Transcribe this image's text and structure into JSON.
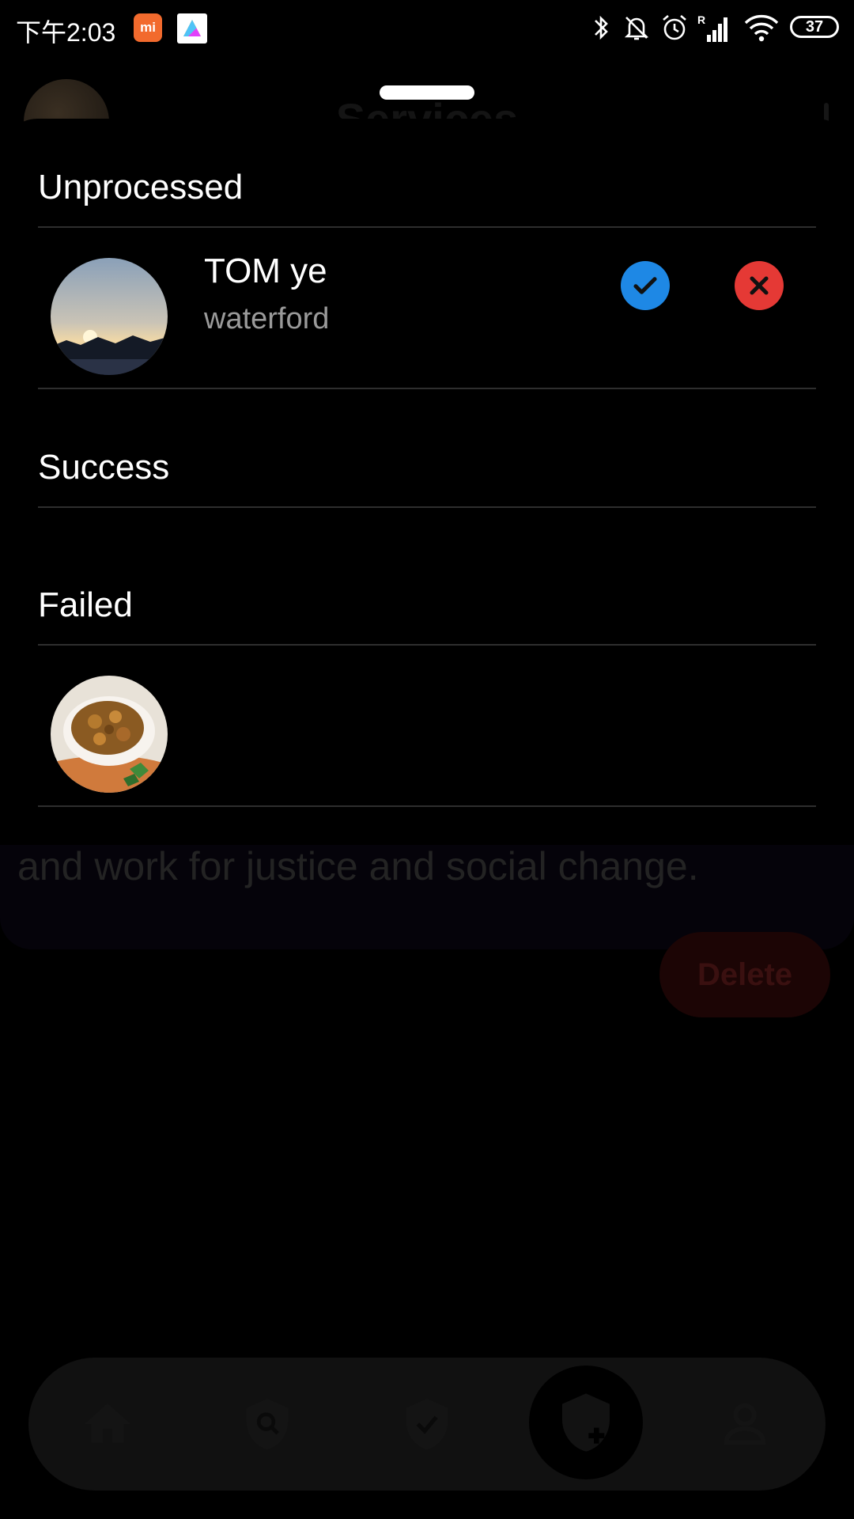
{
  "status_bar": {
    "time": "下午2:03",
    "battery": "37",
    "notification_icons": [
      "mi-app-icon",
      "app-icon"
    ],
    "system_icons": [
      "bluetooth-icon",
      "bell-off-icon",
      "alarm-icon",
      "signal-icon",
      "wifi-icon",
      "battery-icon"
    ]
  },
  "background": {
    "title": "Services",
    "card_text": "and work for justice and social change.",
    "delete_label": "Delete",
    "nav_items": [
      "home-icon",
      "shield-search-icon",
      "shield-check-icon",
      "shield-add-icon",
      "person-icon"
    ]
  },
  "sheet": {
    "sections": {
      "unprocessed": "Unprocessed",
      "success": "Success",
      "failed": "Failed"
    },
    "unprocessed_item": {
      "name": "TOM ye",
      "location": "waterford"
    }
  },
  "colors": {
    "accept": "#1e88e5",
    "reject": "#e53935",
    "divider": "#2e2e2e"
  }
}
